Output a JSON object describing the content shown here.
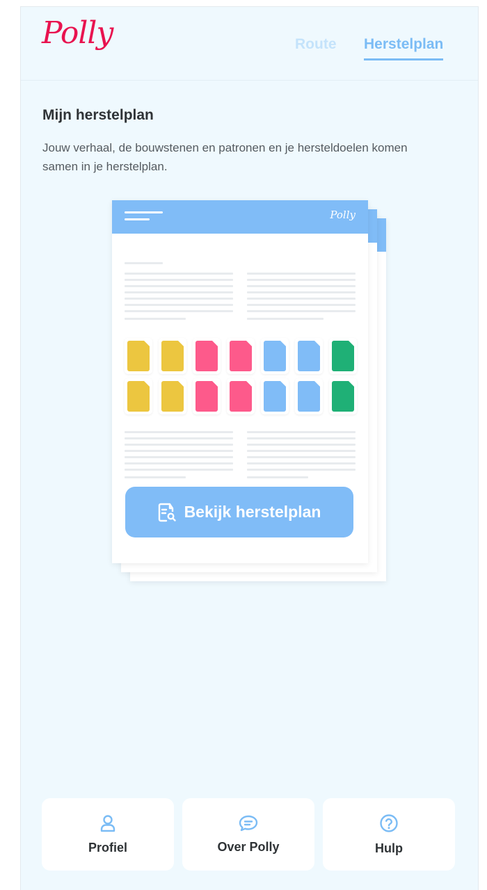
{
  "header": {
    "logo": "Polly",
    "nav": [
      {
        "label": "Route",
        "active": false
      },
      {
        "label": "Herstelplan",
        "active": true
      }
    ]
  },
  "main": {
    "title": "Mijn herstelplan",
    "description": "Jouw verhaal, de bouwstenen en patronen en je hersteldoelen komen samen in je herstelplan.",
    "illustration": {
      "mini_logo": "Polly",
      "tile_colors": [
        "#ecc640",
        "#ecc640",
        "#fd5a8b",
        "#fd5a8b",
        "#80bcf7",
        "#80bcf7",
        "#1fb076"
      ]
    },
    "cta_label": "Bekijk herstelplan"
  },
  "bottom_nav": [
    {
      "label": "Profiel",
      "icon": "user-icon"
    },
    {
      "label": "Over Polly",
      "icon": "chat-icon"
    },
    {
      "label": "Hulp",
      "icon": "help-circle-icon"
    }
  ],
  "colors": {
    "brand": "#e8134f",
    "accent": "#7bbcf5",
    "background": "#eff9fe"
  }
}
